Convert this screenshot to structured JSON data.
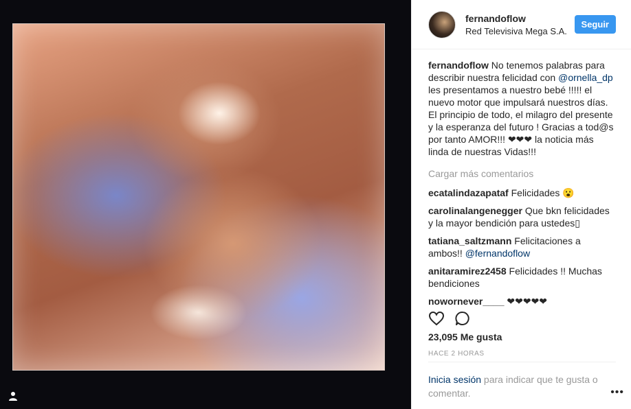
{
  "post": {
    "username": "fernandoflow",
    "location": "Red Televisiva Mega S.A.",
    "follow_label": "Seguir",
    "caption": {
      "user": "fernandoflow",
      "pre": " No tenemos palabras para describir nuestra felicidad con ",
      "mention": "@ornella_dp",
      "post": " les presentamos a nuestro bebé !!!!! el nuevo motor que impulsará nuestros días. El principio de todo, el milagro del presente y la esperanza del futuro ! Gracias a tod@s por tanto AMOR!!! ❤❤❤ la noticia más linda de nuestras Vidas!!!"
    },
    "load_more": "Cargar más comentarios",
    "comments": [
      {
        "user": "ecatalindazapataf",
        "text": " Felicidades 😮"
      },
      {
        "user": "carolinalangenegger",
        "text": " Que bkn felicidades y la mayor bendición para ustedes▯"
      },
      {
        "user": "tatiana_saltzmann",
        "text": " Felicitaciones a ambos!! ",
        "mention": "@fernandoflow"
      },
      {
        "user": "anitaramirez2458",
        "text": " Felicidades !! Muchas bendiciones"
      },
      {
        "user": "nowornever____",
        "text": " ❤❤❤❤❤"
      }
    ],
    "likes": "23,095 Me gusta",
    "time": "HACE 2 HORAS",
    "login_link": "Inicia sesión",
    "login_rest": " para indicar que te gusta o comentar.",
    "more_options": "•••"
  },
  "icons": {
    "like": "heart-icon",
    "comment": "comment-bubble-icon",
    "user_tag": "person-icon"
  }
}
